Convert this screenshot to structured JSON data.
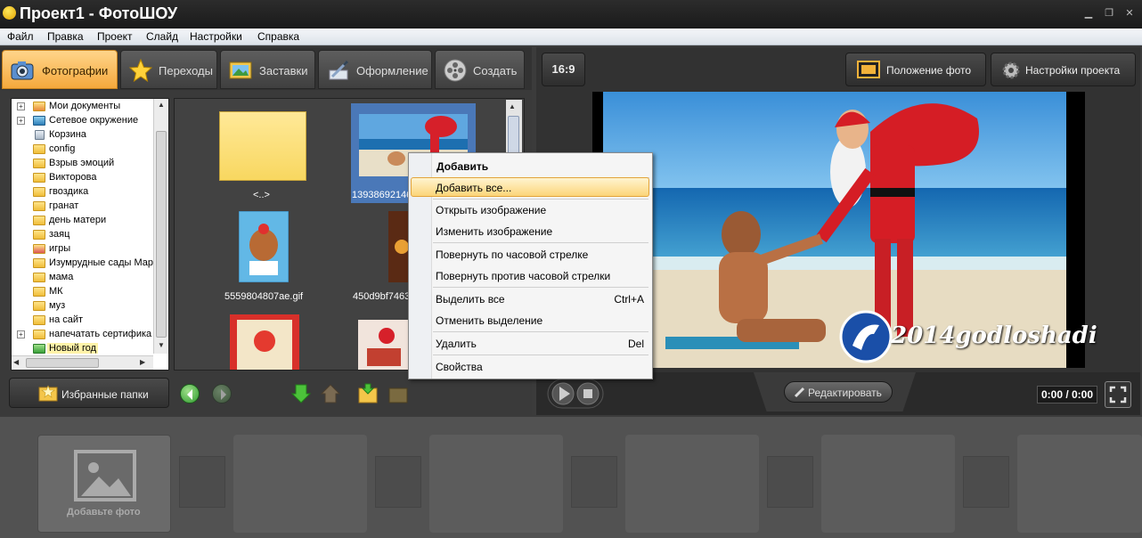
{
  "window": {
    "title": "Проект1 - ФотоШОУ",
    "min": "▁",
    "max": "❐",
    "close": "✕"
  },
  "menu": [
    "Файл",
    "Правка",
    "Проект",
    "Слайд",
    "Настройки",
    "Справка"
  ],
  "tabs": [
    {
      "label": "Фотографии",
      "icon": "camera-icon",
      "active": true
    },
    {
      "label": "Переходы",
      "icon": "star-icon"
    },
    {
      "label": "Заставки",
      "icon": "picture-icon"
    },
    {
      "label": "Оформление",
      "icon": "brush-icon"
    },
    {
      "label": "Создать",
      "icon": "film-reel-icon"
    }
  ],
  "tree": [
    {
      "label": "Мои документы",
      "expandable": true
    },
    {
      "label": "Сетевое окружение",
      "expandable": true
    },
    {
      "label": "Корзина"
    },
    {
      "label": "config"
    },
    {
      "label": "Взрыв эмоций"
    },
    {
      "label": "Викторова"
    },
    {
      "label": "гвоздика"
    },
    {
      "label": "гранат"
    },
    {
      "label": "день матери"
    },
    {
      "label": "заяц"
    },
    {
      "label": "игры"
    },
    {
      "label": "Изумрудные сады Мар"
    },
    {
      "label": "мама"
    },
    {
      "label": "МК"
    },
    {
      "label": "муз"
    },
    {
      "label": "на сайт"
    },
    {
      "label": "напечатать сертифика",
      "expandable": true
    },
    {
      "label": "Новый год",
      "selected": true
    }
  ],
  "files": [
    {
      "caption": "<..>"
    },
    {
      "caption": "13938692146"
    },
    {
      "caption": "5559804807ae.gif"
    },
    {
      "caption": "450d9bf7463"
    }
  ],
  "favorites_label": "Избранные папки",
  "aspect_label": "16:9",
  "photo_position_label": "Положение фото",
  "project_settings_label": "Настройки проекта",
  "watermark": "2014godloshadi",
  "edit_label": "Редактировать",
  "time": "0:00 / 0:00",
  "add_photo_label": "Добавьте фото",
  "context_menu": {
    "add": "Добавить",
    "add_all": "Добавить все...",
    "open": "Открыть изображение",
    "edit": "Изменить изображение",
    "rotate_cw": "Повернуть по часовой стрелке",
    "rotate_ccw": "Повернуть против часовой стрелки",
    "select_all": "Выделить все",
    "select_all_shortcut": "Ctrl+A",
    "deselect": "Отменить выделение",
    "delete": "Удалить",
    "delete_shortcut": "Del",
    "properties": "Свойства"
  },
  "colors": {
    "accent": "#f5a83c",
    "highlight": "#fcd579"
  }
}
